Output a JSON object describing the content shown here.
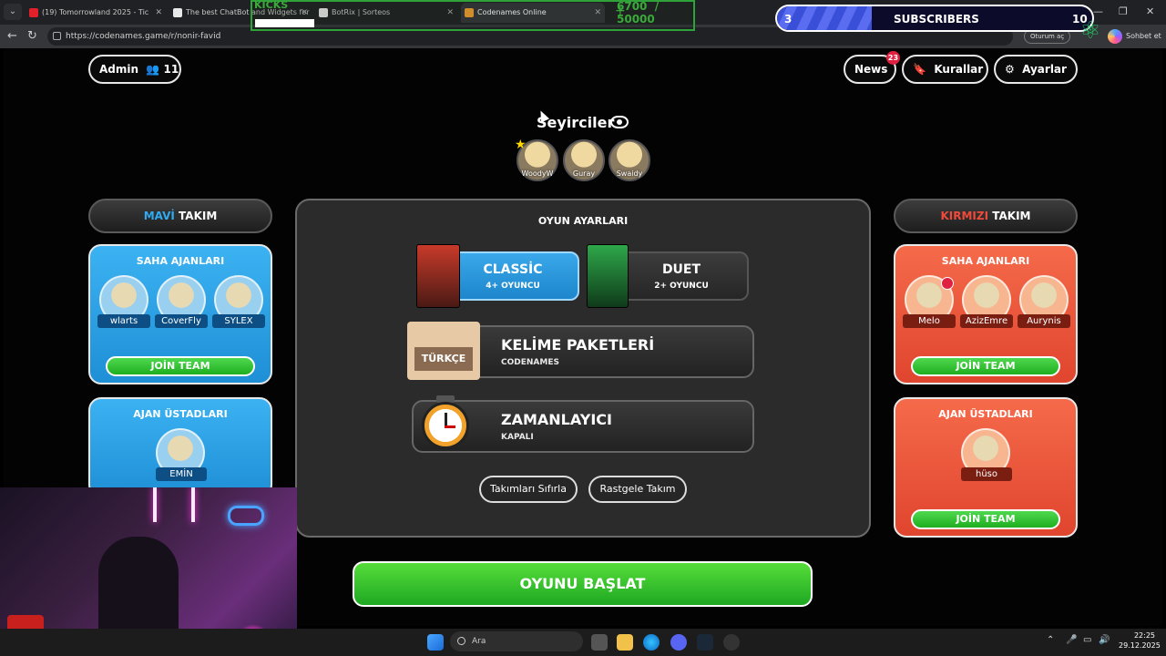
{
  "browser": {
    "tabs": [
      {
        "label": "(19) Tomorrowland 2025 - Tic",
        "favicon_color": "#e0202a"
      },
      {
        "label": "The best ChatBot and Widgets for",
        "favicon_color": "#e8e8e8"
      },
      {
        "label": "BotRix | Sorteos",
        "favicon_color": "#e8e8e8"
      },
      {
        "label": "Codenames Online",
        "favicon_color": "#f0a030"
      }
    ],
    "url": "https://codenames.game/r/nonir-favid",
    "profile_label": "Oturum aç",
    "copilot_label": "Sohbet et"
  },
  "overlay": {
    "kicks_label": "KICKS",
    "kicks_count": "6700",
    "kicks_goal": "/ 50000",
    "kicks_progress": 0.134,
    "subs_current": "3",
    "subs_title": "SUBSCRIBERS",
    "subs_goal": "10",
    "subs_progress": 0.3
  },
  "header": {
    "admin_label": "Admin",
    "player_count": "11",
    "news_label": "News",
    "news_badge": "23",
    "rules_label": "Kurallar",
    "settings_label": "Ayarlar"
  },
  "spectators": {
    "title": "Seyirciler",
    "people": [
      "WoodyW",
      "Guray",
      "Swaidy"
    ]
  },
  "blue_team": {
    "title_color_word": "MAVİ",
    "title_word": "TAKIM",
    "field_agents_title": "SAHA AJANLARI",
    "field_agents": [
      "wlarts",
      "CoverFly",
      "SYLEX"
    ],
    "join_label": "JOİN TEAM",
    "spymasters_title": "AJAN ÜSTADLARI",
    "spymasters": [
      "EMİN"
    ]
  },
  "red_team": {
    "title_color_word": "KIRMIZI",
    "title_word": "TAKIM",
    "field_agents_title": "SAHA AJANLARI",
    "field_agents": [
      "Melo",
      "AzizEmre",
      "Aurynis"
    ],
    "join_label": "JOİN TEAM",
    "spymasters_title": "AJAN ÜSTADLARI",
    "spymasters": [
      "hüso"
    ],
    "join_label_2": "JOİN TEAM"
  },
  "settings": {
    "title": "OYUN AYARLARI",
    "modes": [
      {
        "name": "CLASSİC",
        "sub": "4+ OYUNCU",
        "selected": true
      },
      {
        "name": "DUET",
        "sub": "2+ OYUNCU",
        "selected": false
      }
    ],
    "word_pack": {
      "title": "KELİME PAKETLERİ",
      "sub": "CODENAMES",
      "badge": "TÜRKÇE"
    },
    "timer": {
      "title": "ZAMANLAYICI",
      "sub": "KAPALI"
    },
    "reset_teams": "Takımları Sıfırla",
    "random_teams": "Rastgele Takım",
    "start_label": "OYUNU BAŞLAT"
  },
  "taskbar": {
    "search_placeholder": "Ara",
    "time": "22:25",
    "date": "29.12.2025"
  },
  "colors": {
    "blue": "#30aaf0",
    "red": "#f04a3a",
    "green": "#1ea822"
  }
}
